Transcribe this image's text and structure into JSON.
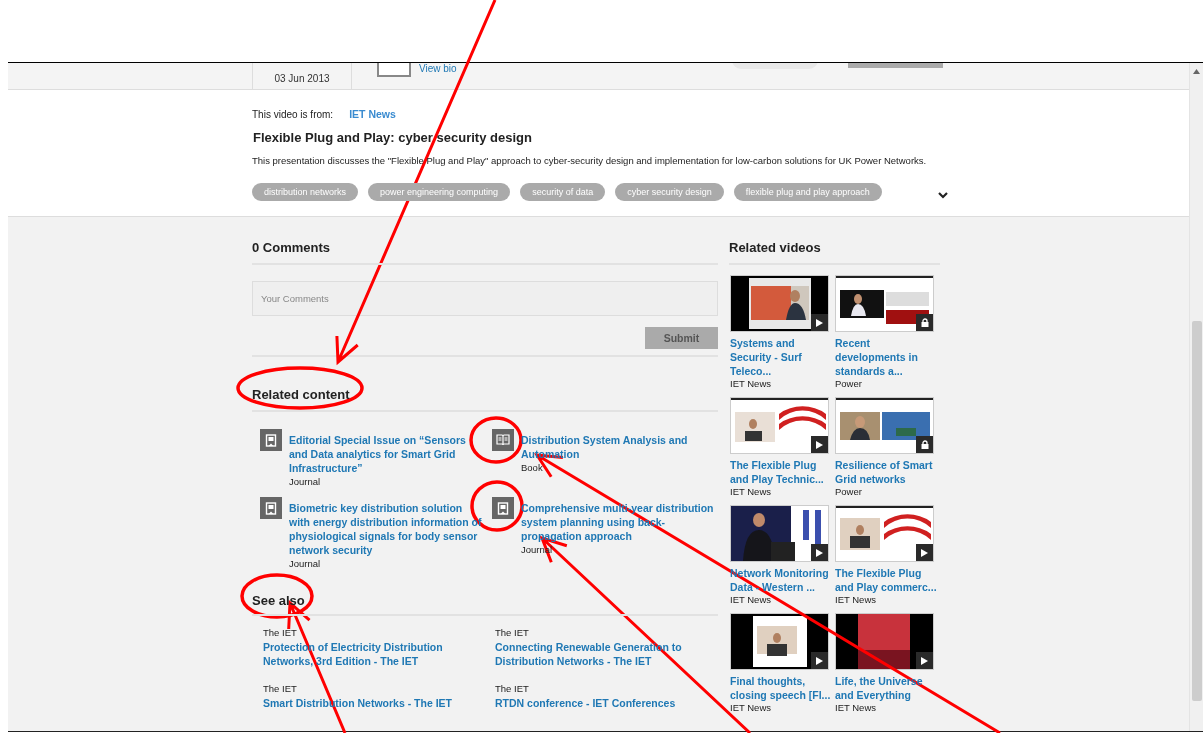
{
  "header": {
    "date": "03 Jun 2013",
    "link": "View bio"
  },
  "video": {
    "source_label": "This video is from:",
    "source": "IET News",
    "title": "Flexible Plug and Play: cyber security design",
    "description": "This presentation discusses the \"Flexible Plug and Play\" approach to cyber-security design and implementation for low-carbon solutions for UK Power Networks.",
    "tags": [
      "distribution networks",
      "power engineering computing",
      "security of data",
      "cyber security design",
      "flexible plug and play approach"
    ]
  },
  "comments": {
    "heading": "0 Comments",
    "placeholder": "Your Comments",
    "submit": "Submit"
  },
  "related_content": {
    "heading": "Related content",
    "items": [
      {
        "kind": "journal",
        "title": "Editorial Special Issue on “Sensors and Data analytics for Smart Grid Infrastructure”",
        "type": "Journal"
      },
      {
        "kind": "book",
        "title": "Distribution System Analysis and Automation",
        "type": "Book"
      },
      {
        "kind": "journal",
        "title": "Biometric key distribution solution with energy distribution information of physiological signals for body sensor network security",
        "type": "Journal"
      },
      {
        "kind": "journal",
        "title": "Comprehensive multi-year distribution system planning using back-propagation approach",
        "type": "Journal"
      }
    ]
  },
  "see_also": {
    "heading": "See also",
    "items": [
      {
        "publisher": "The IET",
        "title": "Protection of Electricity Distribution Networks, 3rd Edition - The IET"
      },
      {
        "publisher": "The IET",
        "title": "Connecting Renewable Generation to Distribution Networks - The IET"
      },
      {
        "publisher": "The IET",
        "title": "Smart Distribution Networks - The IET"
      },
      {
        "publisher": "The IET",
        "title": "RTDN conference - IET Conferences"
      }
    ]
  },
  "related_videos": {
    "heading": "Related videos",
    "items": [
      {
        "title": "Systems and Security - Surf Teleco...",
        "source": "IET News",
        "locked": false
      },
      {
        "title": "Recent developments in standards a...",
        "source": "Power",
        "locked": true
      },
      {
        "title": "The Flexible Plug and Play Technic...",
        "source": "IET News",
        "locked": false
      },
      {
        "title": "Resilience of Smart Grid networks",
        "source": "Power",
        "locked": true
      },
      {
        "title": "Network Monitoring Data - Western ...",
        "source": "IET News",
        "locked": false
      },
      {
        "title": "The Flexible Plug and Play commerc...",
        "source": "IET News",
        "locked": false
      },
      {
        "title": "Final thoughts, closing speech [Fl...",
        "source": "IET News",
        "locked": false
      },
      {
        "title": "Life, the Universe and Everything",
        "source": "IET News",
        "locked": false
      }
    ]
  }
}
